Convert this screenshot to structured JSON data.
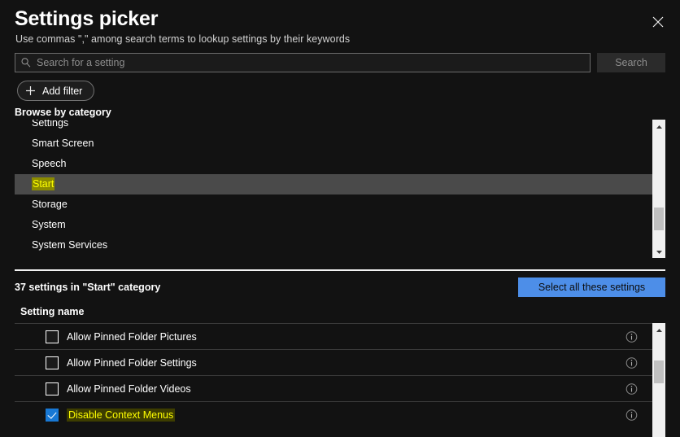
{
  "dialog": {
    "title": "Settings picker",
    "subtitle": "Use commas \",\" among search terms to lookup settings by their keywords",
    "close_label": "Close"
  },
  "search": {
    "placeholder": "Search for a setting",
    "value": "",
    "button_label": "Search",
    "icon": "search-icon"
  },
  "filters": {
    "add_filter_label": "Add filter",
    "add_filter_icon": "plus-icon"
  },
  "categories": {
    "heading": "Browse by category",
    "selected": "Start",
    "items": [
      {
        "label": "Settings",
        "selected": false
      },
      {
        "label": "Smart Screen",
        "selected": false
      },
      {
        "label": "Speech",
        "selected": false
      },
      {
        "label": "Start",
        "selected": true
      },
      {
        "label": "Storage",
        "selected": false
      },
      {
        "label": "System",
        "selected": false
      },
      {
        "label": "System Services",
        "selected": false
      }
    ],
    "scrollbar": {
      "up_icon": "caret-up-icon",
      "down_icon": "caret-down-icon"
    }
  },
  "results": {
    "count_text": "37 settings in \"Start\" category",
    "select_all_label": "Select all these settings",
    "column_header": "Setting name",
    "rows": [
      {
        "label": "Allow Pinned Folder Pictures",
        "checked": false,
        "highlighted": false,
        "info_icon": "info-icon"
      },
      {
        "label": "Allow Pinned Folder Settings",
        "checked": false,
        "highlighted": false,
        "info_icon": "info-icon"
      },
      {
        "label": "Allow Pinned Folder Videos",
        "checked": false,
        "highlighted": false,
        "info_icon": "info-icon"
      },
      {
        "label": "Disable Context Menus",
        "checked": true,
        "highlighted": true,
        "info_icon": "info-icon"
      }
    ],
    "scrollbar": {
      "up_icon": "caret-up-icon"
    }
  },
  "colors": {
    "background": "#121212",
    "accent_blue": "#4d8ee8",
    "checkbox_blue": "#1878d4",
    "highlight_yellow": "#ffff00",
    "selected_row": "#4a4a4a",
    "scrollbar_track": "#f0f0f0",
    "scrollbar_thumb": "#c0c0c0"
  }
}
